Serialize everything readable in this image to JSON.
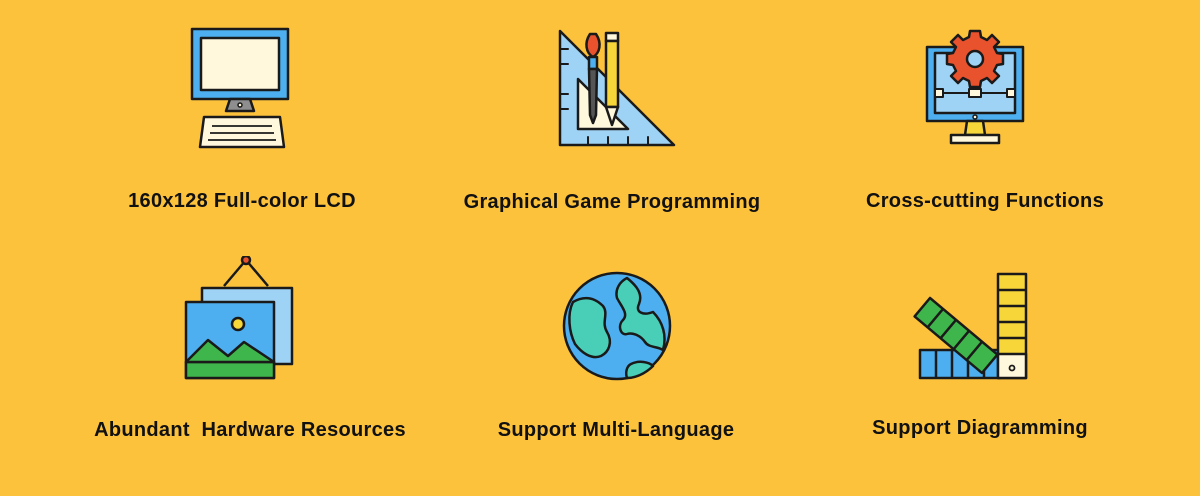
{
  "background_color": "#fdc23c",
  "features": [
    {
      "label": "160x128 Full-color LCD",
      "icon": "computer-monitor-icon"
    },
    {
      "label": "Graphical Game Programming",
      "icon": "drawing-tools-icon"
    },
    {
      "label": "Cross-cutting Functions",
      "icon": "gear-monitor-icon"
    },
    {
      "label": "Abundant  Hardware Resources",
      "icon": "picture-frame-icon"
    },
    {
      "label": "Support Multi-Language",
      "icon": "globe-icon"
    },
    {
      "label": "Support Diagramming",
      "icon": "color-swatch-icon"
    }
  ],
  "colors": {
    "outline": "#1a1a1a",
    "blue": "#4dafef",
    "light_blue": "#9fd3f5",
    "teal": "#49cfb8",
    "cream": "#fff8dd",
    "red": "#e8522c",
    "green": "#3fb64b",
    "yellow": "#f7d63a"
  }
}
